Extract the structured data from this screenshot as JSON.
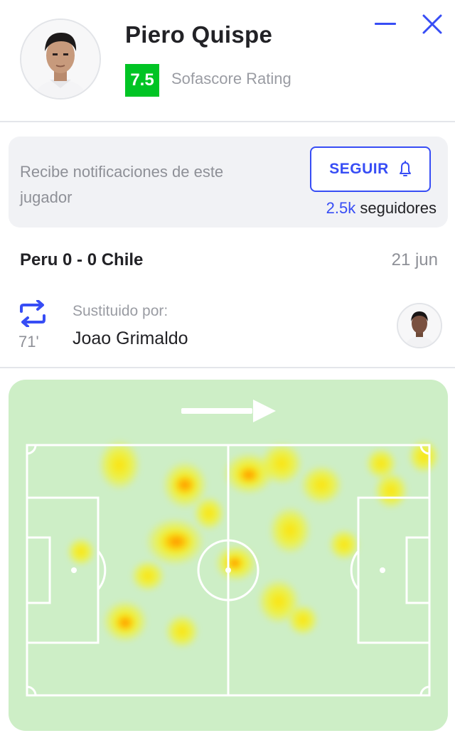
{
  "player": {
    "name": "Piero Quispe",
    "rating": "7.5",
    "rating_label": "Sofascore Rating",
    "rating_color": "#00c424"
  },
  "window_controls": {
    "minimize_icon": "minimize-icon",
    "close_icon": "close-icon"
  },
  "notify": {
    "text": "Recibe notificaciones de este jugador",
    "follow_label": "SEGUIR",
    "follow_icon": "bell-icon",
    "followers_count": "2.5k",
    "followers_suffix": " seguidores",
    "accent_color": "#374df5"
  },
  "match": {
    "score": "Peru 0 - 0 Chile",
    "date": "21 jun"
  },
  "substitution": {
    "icon": "substitution-icon",
    "minute": "71'",
    "label": "Sustituido por:",
    "player_name": "Joao Grimaldo"
  },
  "heatmap": {
    "direction_icon": "attack-direction-arrow-icon",
    "pitch_color": "#cdeec6"
  }
}
